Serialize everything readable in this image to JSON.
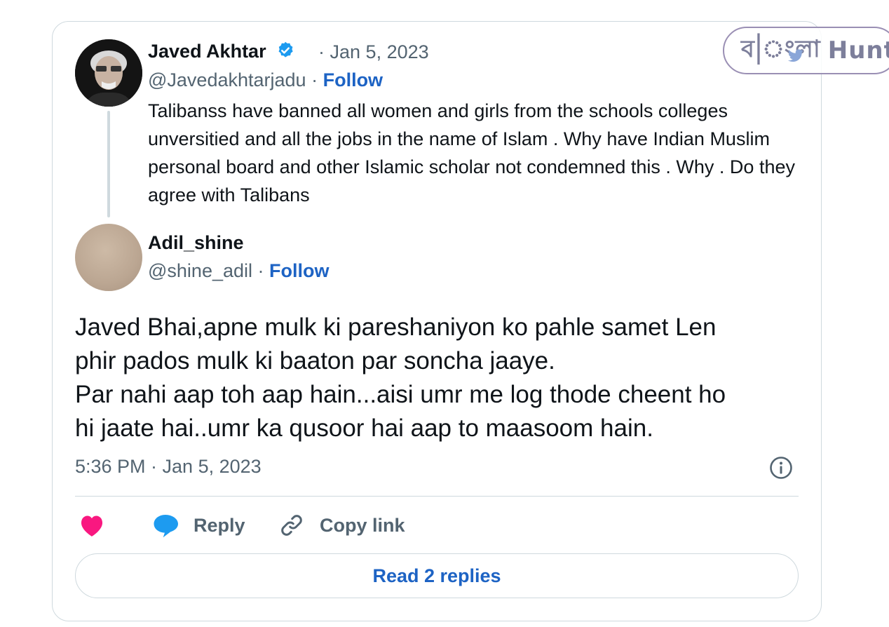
{
  "watermark": {
    "text": "বাংলা Hunt"
  },
  "quoted_tweet": {
    "author_name": "Javed Akhtar",
    "date": "Jan 5, 2023",
    "handle": "@Javedakhtarjadu",
    "follow_label": "Follow",
    "separator": "·",
    "text": "Talibanss have banned all women and girls from the schools colleges unversitied and all the jobs in the name of Islam . Why have Indian Muslim personal board and other Islamic scholar not condemned this . Why . Do they agree with Talibans"
  },
  "reply_tweet": {
    "author_name": "Adil_shine",
    "handle": "@shine_adil",
    "follow_label": "Follow",
    "separator": "·",
    "text_lines": [
      "Javed Bhai,apne mulk ki pareshaniyon ko pahle samet Len",
      "phir pados mulk ki baaton par soncha jaaye.",
      "Par nahi aap toh aap hain...aisi umr me log thode cheent ho",
      "hi jaate hai..umr ka qusoor hai aap to maasoom hain."
    ],
    "timestamp": "5:36 PM · Jan 5, 2023"
  },
  "actions": {
    "reply_label": "Reply",
    "copy_link_label": "Copy link",
    "read_replies_label": "Read 2 replies"
  },
  "icons": [
    "verified-badge-icon",
    "info-icon",
    "heart-icon",
    "reply-bubble-icon",
    "link-icon",
    "bird-icon"
  ],
  "colors": {
    "accent": "#1d63c4",
    "verified": "#1d9bf0",
    "heart": "#f91880",
    "reply_bubble": "#1d9bf0",
    "border": "#cfd9de",
    "secondary_text": "#536471"
  }
}
